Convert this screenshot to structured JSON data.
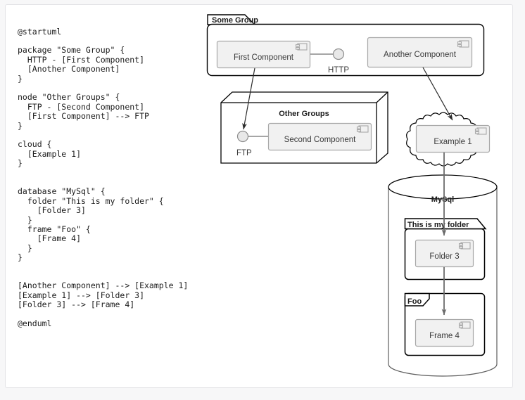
{
  "page": {
    "background": "#f7f7f8",
    "panel_background": "#ffffff",
    "panel_border": "#e3e3e6"
  },
  "source": {
    "name": "plantuml-source",
    "text": "@startuml\n\npackage \"Some Group\" {\n  HTTP - [First Component]\n  [Another Component]\n}\n\nnode \"Other Groups\" {\n  FTP - [Second Component]\n  [First Component] --> FTP\n}\n\ncloud {\n  [Example 1]\n}\n\n\ndatabase \"MySql\" {\n  folder \"This is my folder\" {\n    [Folder 3]\n  }\n  frame \"Foo\" {\n    [Frame 4]\n  }\n}\n\n\n[Another Component] --> [Example 1]\n[Example 1] --> [Folder 3]\n[Folder 3] --> [Frame 4]\n\n@enduml"
  },
  "diagram": {
    "type": "plantuml-component-diagram",
    "colors": {
      "component_fill": "#f1f1f1",
      "component_stroke": "#a8a8a8",
      "container_stroke": "#000000",
      "container_fill": "#ffffff",
      "arrow_stroke": "#6b6b6b",
      "node_arrow_stroke": "#2b2b2b",
      "interface_fill": "#e8e8e8",
      "text": "#1b1b1b",
      "label_text": "#3a3a3a"
    },
    "containers": [
      {
        "id": "some-group",
        "kind": "package",
        "label": "Some Group"
      },
      {
        "id": "other-groups",
        "kind": "node",
        "label": "Other Groups"
      },
      {
        "id": "cloud",
        "kind": "cloud",
        "label": ""
      },
      {
        "id": "mysql",
        "kind": "database",
        "label": "MySql"
      },
      {
        "id": "this-is-my-folder",
        "kind": "folder",
        "label": "This is my folder"
      },
      {
        "id": "foo",
        "kind": "frame",
        "label": "Foo"
      }
    ],
    "components": [
      {
        "id": "first-component",
        "label": "First Component",
        "icon": "component-icon"
      },
      {
        "id": "another-component",
        "label": "Another Component",
        "icon": "component-icon"
      },
      {
        "id": "second-component",
        "label": "Second Component",
        "icon": "component-icon"
      },
      {
        "id": "example-1",
        "label": "Example 1",
        "icon": "component-icon"
      },
      {
        "id": "folder-3",
        "label": "Folder 3",
        "icon": "component-icon"
      },
      {
        "id": "frame-4",
        "label": "Frame 4",
        "icon": "component-icon"
      }
    ],
    "interfaces": [
      {
        "id": "http",
        "label": "HTTP"
      },
      {
        "id": "ftp",
        "label": "FTP"
      }
    ],
    "edges": [
      {
        "from": "first-component",
        "to": "ftp",
        "arrow": true
      },
      {
        "from": "another-component",
        "to": "example-1",
        "arrow": true
      },
      {
        "from": "example-1",
        "to": "folder-3",
        "arrow": true
      },
      {
        "from": "folder-3",
        "to": "frame-4",
        "arrow": true
      },
      {
        "from": "http",
        "to": "first-component",
        "arrow": false
      },
      {
        "from": "ftp",
        "to": "second-component",
        "arrow": false
      }
    ]
  }
}
